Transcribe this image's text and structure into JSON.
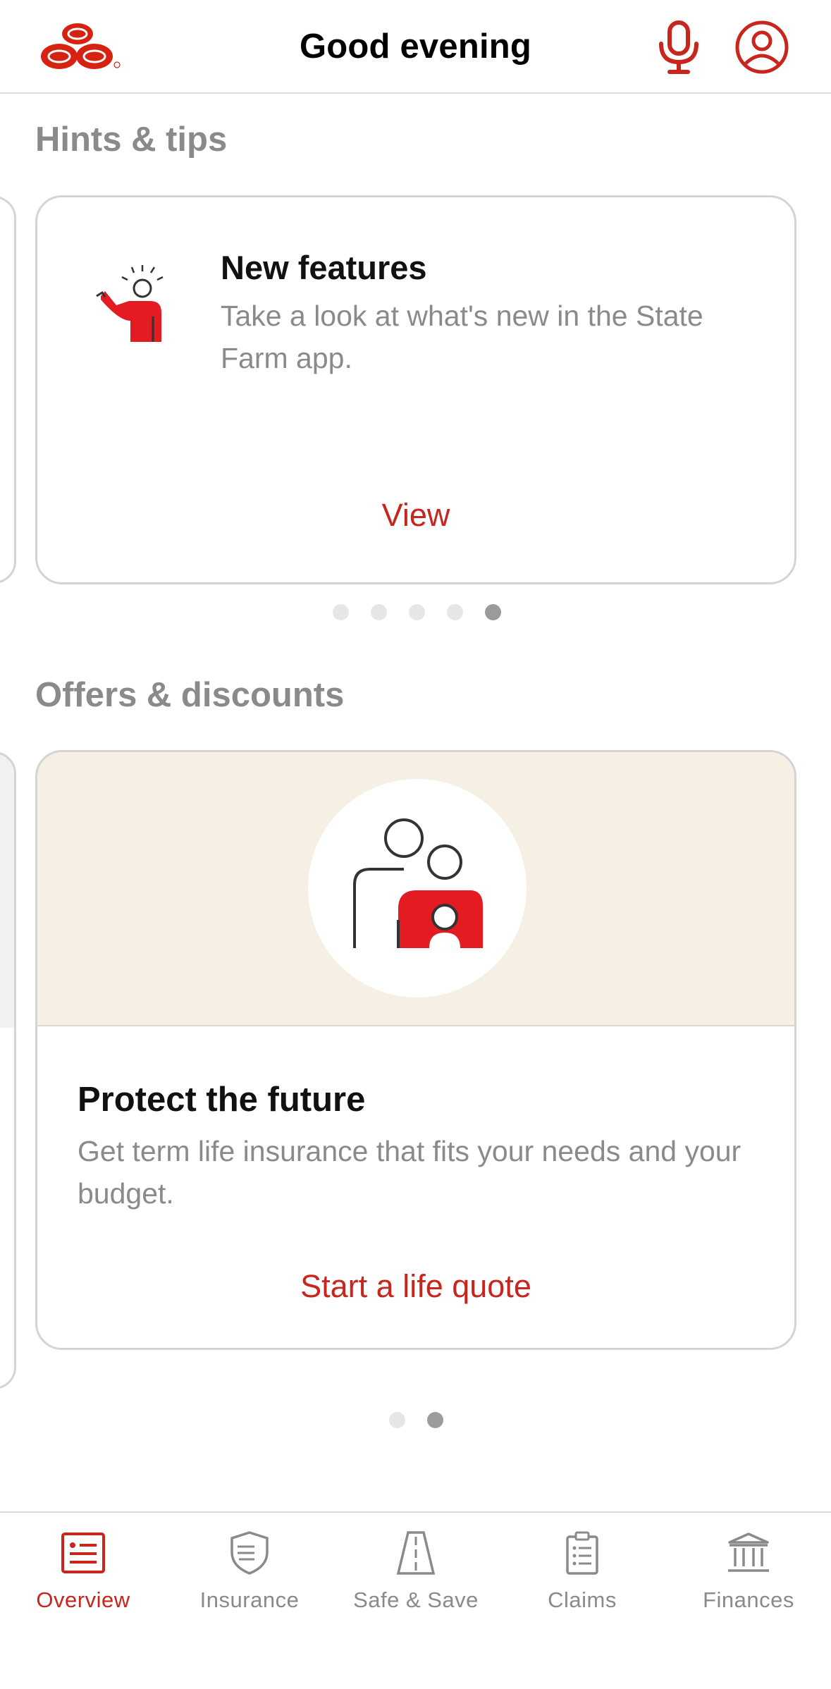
{
  "header": {
    "greeting": "Good evening",
    "logo_icon": "state-farm-logo",
    "mic_icon": "microphone-icon",
    "profile_icon": "profile-icon"
  },
  "colors": {
    "brand_red": "#c8251c",
    "muted_text": "#8a8a8a",
    "offer_bg": "#f5efe4"
  },
  "hints": {
    "section_title": "Hints & tips",
    "card": {
      "title": "New features",
      "description": "Take a look at what's new in the State Farm app.",
      "action": "View"
    },
    "pager": {
      "total": 5,
      "active_index": 4
    }
  },
  "offers": {
    "section_title": "Offers & discounts",
    "card": {
      "title": "Protect the future",
      "description": "Get term life insurance that fits your needs and your budget.",
      "action": "Start a life quote"
    },
    "pager": {
      "total": 2,
      "active_index": 1
    }
  },
  "tabbar": {
    "tabs": [
      {
        "label": "Overview",
        "icon": "overview-icon",
        "active": true
      },
      {
        "label": "Insurance",
        "icon": "shield-icon",
        "active": false
      },
      {
        "label": "Safe & Save",
        "icon": "road-icon",
        "active": false
      },
      {
        "label": "Claims",
        "icon": "clipboard-icon",
        "active": false
      },
      {
        "label": "Finances",
        "icon": "bank-icon",
        "active": false
      }
    ]
  }
}
